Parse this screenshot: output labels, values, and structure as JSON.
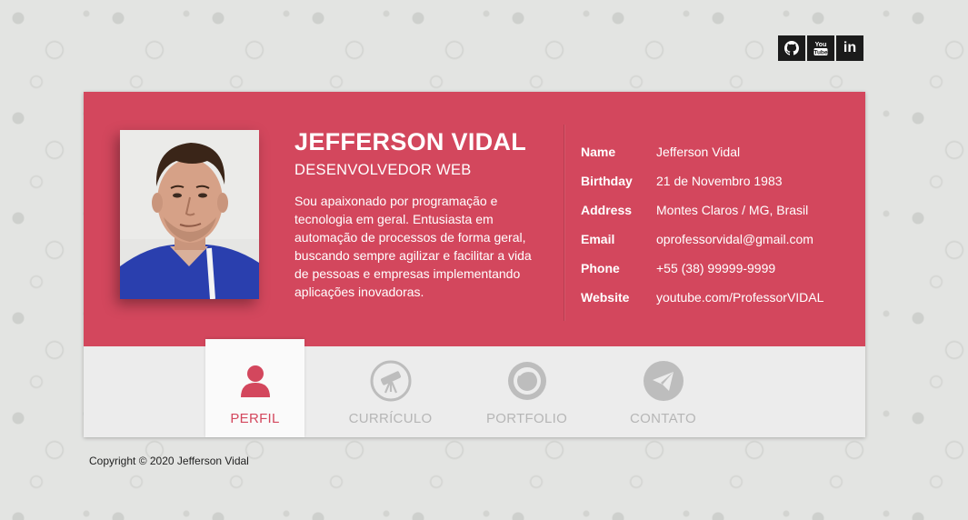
{
  "social": [
    {
      "icon": "github-icon",
      "label": "GitHub"
    },
    {
      "icon": "youtube-icon",
      "label": "You Tube"
    },
    {
      "icon": "linkedin-icon",
      "label": "in"
    }
  ],
  "profile": {
    "name": "JEFFERSON VIDAL",
    "role": "DESENVOLVEDOR WEB",
    "bio": "Sou apaixonado por programação e tecnologia em geral. Entusiasta em automação de processos de forma geral, buscando sempre agilizar e facilitar a vida de pessoas e empresas implementando aplicações inovadoras.",
    "photo_icon": "profile-photo"
  },
  "info": [
    {
      "label": "Name",
      "value": "Jefferson Vidal"
    },
    {
      "label": "Birthday",
      "value": "21 de Novembro 1983"
    },
    {
      "label": "Address",
      "value": "Montes Claros / MG, Brasil"
    },
    {
      "label": "Email",
      "value": "oprofessorvidal@gmail.com"
    },
    {
      "label": "Phone",
      "value": "+55 (38) 99999-9999"
    },
    {
      "label": "Website",
      "value": "youtube.com/ProfessorVIDAL"
    }
  ],
  "tabs": [
    {
      "label": "PERFIL",
      "icon": "user-icon",
      "active": true
    },
    {
      "label": "CURRÍCULO",
      "icon": "telescope-icon",
      "active": false
    },
    {
      "label": "PORTFOLIO",
      "icon": "camera-lens-icon",
      "active": false
    },
    {
      "label": "CONTATO",
      "icon": "paper-plane-icon",
      "active": false
    }
  ],
  "footer": {
    "copyright": "Copyright © 2020 Jefferson Vidal"
  },
  "colors": {
    "accent": "#d3475d",
    "tab_bar": "#ececec",
    "inactive": "#b6b6b6",
    "social_bg": "#1b1b1b"
  }
}
